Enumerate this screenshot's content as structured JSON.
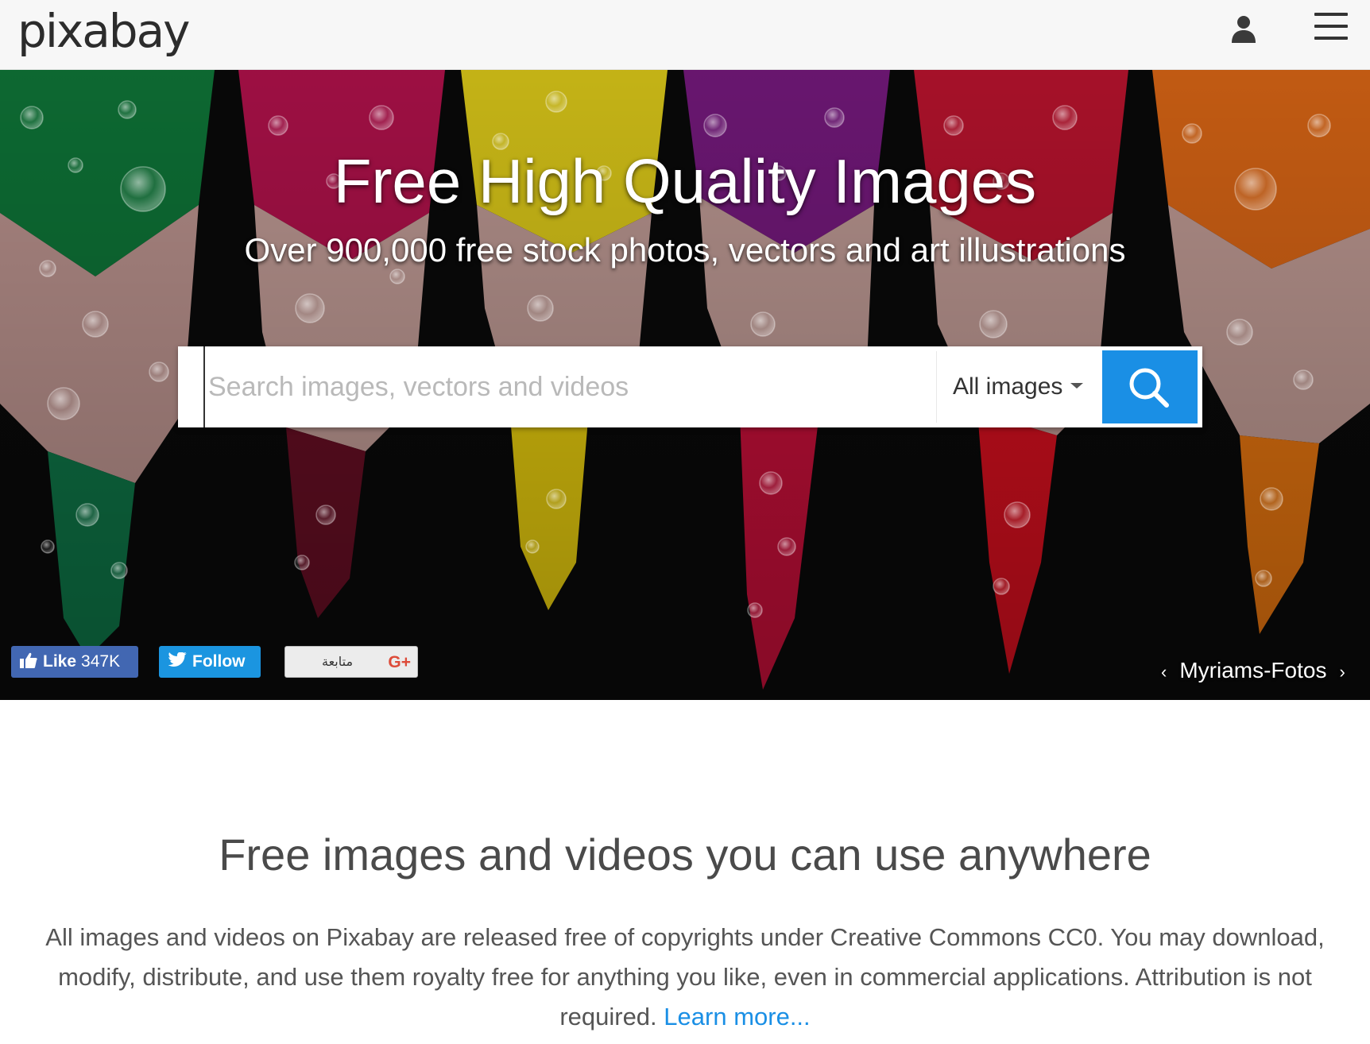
{
  "header": {
    "logo": "pixabay",
    "user_icon": "user-icon",
    "menu_icon": "hamburger-menu-icon"
  },
  "hero": {
    "title": "Free High Quality Images",
    "subtitle": "Over 900,000 free stock photos, vectors and art illustrations",
    "search": {
      "placeholder": "Search images, vectors and videos",
      "value": "",
      "type_label": "All images",
      "button_icon": "search-icon"
    },
    "social": {
      "facebook_label": "Like",
      "facebook_count": "347K",
      "twitter_label": "Follow",
      "gplus_label": "متابعة",
      "gplus_mark": "G+"
    },
    "credit": {
      "photographer": "Myriams-Fotos",
      "prev_icon": "chevron-left-icon",
      "next_icon": "chevron-right-icon"
    }
  },
  "content": {
    "heading": "Free images and videos you can use anywhere",
    "paragraph": "All images and videos on Pixabay are released free of copyrights under Creative Commons CC0. You may download, modify, distribute, and use them royalty free for anything you like, even in commercial applications. Attribution is not required.",
    "link_label": "Learn more..."
  },
  "colors": {
    "accent": "#1a8fe5",
    "facebook": "#4267b2",
    "twitter": "#1b95e0",
    "gplus": "#dd4b39"
  }
}
